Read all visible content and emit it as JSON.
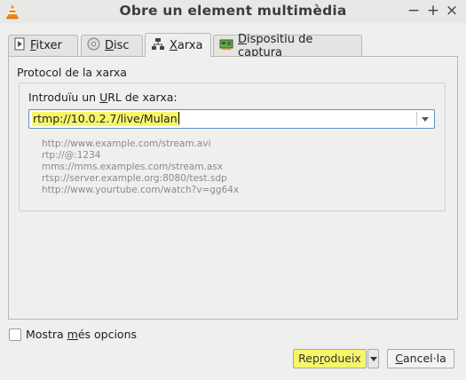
{
  "window": {
    "title": "Obre un element multimèdia",
    "controls": {
      "minimize": "−",
      "maximize": "+",
      "close": "×"
    }
  },
  "tabs": [
    {
      "label": "Fitxer",
      "mnemonic": "F",
      "rest": "itxer",
      "icon": "file-icon",
      "active": false
    },
    {
      "label": "Disc",
      "mnemonic": "D",
      "rest": "isc",
      "icon": "disc-icon",
      "active": false
    },
    {
      "label": "Xarxa",
      "mnemonic": "X",
      "rest": "arxa",
      "icon": "network-icon",
      "active": true
    },
    {
      "label": "Dispositiu de captura",
      "mnemonic": "D",
      "rest": "ispositiu de captura",
      "icon": "capture-card-icon",
      "active": false
    }
  ],
  "network": {
    "section_title": "Protocol de la xarxa",
    "url_label_pre": "Introduïu un ",
    "url_label_mn": "U",
    "url_label_post": "RL de xarxa:",
    "url_value": "rtmp://10.0.2.7/live/Mulan",
    "examples": [
      "http://www.example.com/stream.avi",
      "rtp://@:1234",
      "mms://mms.examples.com/stream.asx",
      "rtsp://server.example.org:8080/test.sdp",
      "http://www.yourtube.com/watch?v=gg64x"
    ]
  },
  "options": {
    "show_more_pre": "Mostra ",
    "show_more_mn": "m",
    "show_more_post": "és opcions",
    "checked": false
  },
  "buttons": {
    "play_pre": "Rep",
    "play_mn": "r",
    "play_post": "odueix",
    "cancel_mn": "C",
    "cancel_post": "ancel·la"
  },
  "colors": {
    "highlight": "#f6f66b",
    "focus_border": "#5d8fcf"
  }
}
